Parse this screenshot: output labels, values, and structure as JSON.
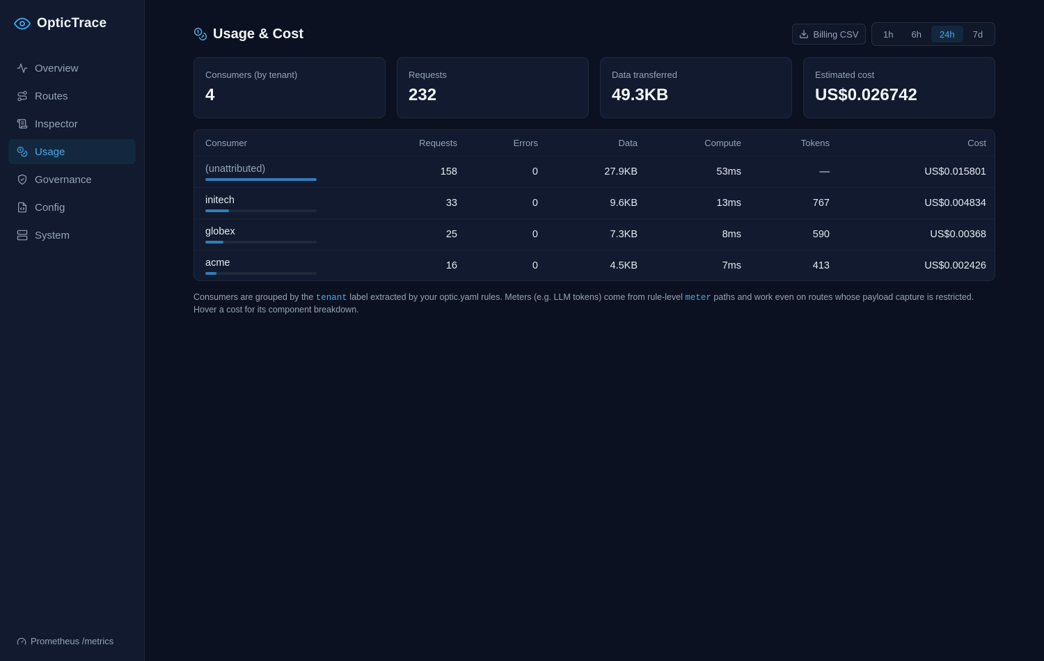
{
  "app": {
    "name": "OpticTrace"
  },
  "sidebar": {
    "items": [
      {
        "label": "Overview",
        "icon": "activity-icon",
        "active": false
      },
      {
        "label": "Routes",
        "icon": "route-icon",
        "active": false
      },
      {
        "label": "Inspector",
        "icon": "scroll-icon",
        "active": false
      },
      {
        "label": "Usage",
        "icon": "coins-icon",
        "active": true
      },
      {
        "label": "Governance",
        "icon": "shield-check-icon",
        "active": false
      },
      {
        "label": "Config",
        "icon": "file-code-icon",
        "active": false
      },
      {
        "label": "System",
        "icon": "server-icon",
        "active": false
      }
    ],
    "footer_link": "Prometheus /metrics"
  },
  "header": {
    "title": "Usage & Cost",
    "csv_button": "Billing CSV",
    "ranges": [
      "1h",
      "6h",
      "24h",
      "7d"
    ],
    "selected_range": "24h"
  },
  "stats": [
    {
      "label": "Consumers (by tenant)",
      "value": "4"
    },
    {
      "label": "Requests",
      "value": "232"
    },
    {
      "label": "Data transferred",
      "value": "49.3KB"
    },
    {
      "label": "Estimated cost",
      "value": "US$0.026742"
    }
  ],
  "table": {
    "columns": [
      "Consumer",
      "Requests",
      "Errors",
      "Data",
      "Compute",
      "Tokens",
      "Cost"
    ],
    "rows": [
      {
        "consumer": "(unattributed)",
        "requests": "158",
        "errors": "0",
        "data": "27.9KB",
        "compute": "53ms",
        "tokens": "—",
        "cost": "US$0.015801",
        "share": 1.0
      },
      {
        "consumer": "initech",
        "requests": "33",
        "errors": "0",
        "data": "9.6KB",
        "compute": "13ms",
        "tokens": "767",
        "cost": "US$0.004834",
        "share": 0.21
      },
      {
        "consumer": "globex",
        "requests": "25",
        "errors": "0",
        "data": "7.3KB",
        "compute": "8ms",
        "tokens": "590",
        "cost": "US$0.00368",
        "share": 0.16
      },
      {
        "consumer": "acme",
        "requests": "16",
        "errors": "0",
        "data": "4.5KB",
        "compute": "7ms",
        "tokens": "413",
        "cost": "US$0.002426",
        "share": 0.1
      }
    ]
  },
  "footnote": {
    "part1": "Consumers are grouped by the ",
    "code1": "tenant",
    "part2": " label extracted by your optic.yaml rules. Meters (e.g. LLM tokens) come from rule-level ",
    "code2": "meter",
    "part3": " paths and work even on routes whose payload capture is restricted. Hover a cost for its component breakdown."
  }
}
